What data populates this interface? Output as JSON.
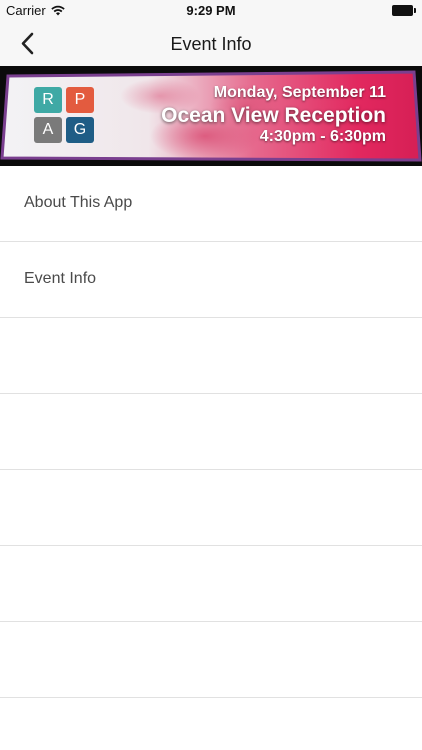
{
  "status_bar": {
    "carrier": "Carrier",
    "time": "9:29 PM"
  },
  "nav": {
    "title": "Event Info",
    "back_icon": "chevron-left-icon"
  },
  "banner": {
    "logo_letters": [
      "R",
      "P",
      "A",
      "G"
    ],
    "logo_colors": [
      "#3fa9a5",
      "#e35b3f",
      "#7a7a7a",
      "#1f5d86"
    ],
    "date": "Monday, September 11",
    "title": "Ocean View Reception",
    "time": "4:30pm - 6:30pm",
    "accent": "#e22a6b",
    "frame_color": "#7a3f8f"
  },
  "menu": {
    "items": [
      {
        "label": "About This App"
      },
      {
        "label": "Event Info"
      },
      {
        "label": ""
      },
      {
        "label": ""
      },
      {
        "label": ""
      },
      {
        "label": ""
      },
      {
        "label": ""
      },
      {
        "label": ""
      }
    ]
  },
  "colors": {
    "bar_background": "#f7f7f7",
    "separator": "#e1e1e1",
    "text": "#4a4a4a"
  }
}
